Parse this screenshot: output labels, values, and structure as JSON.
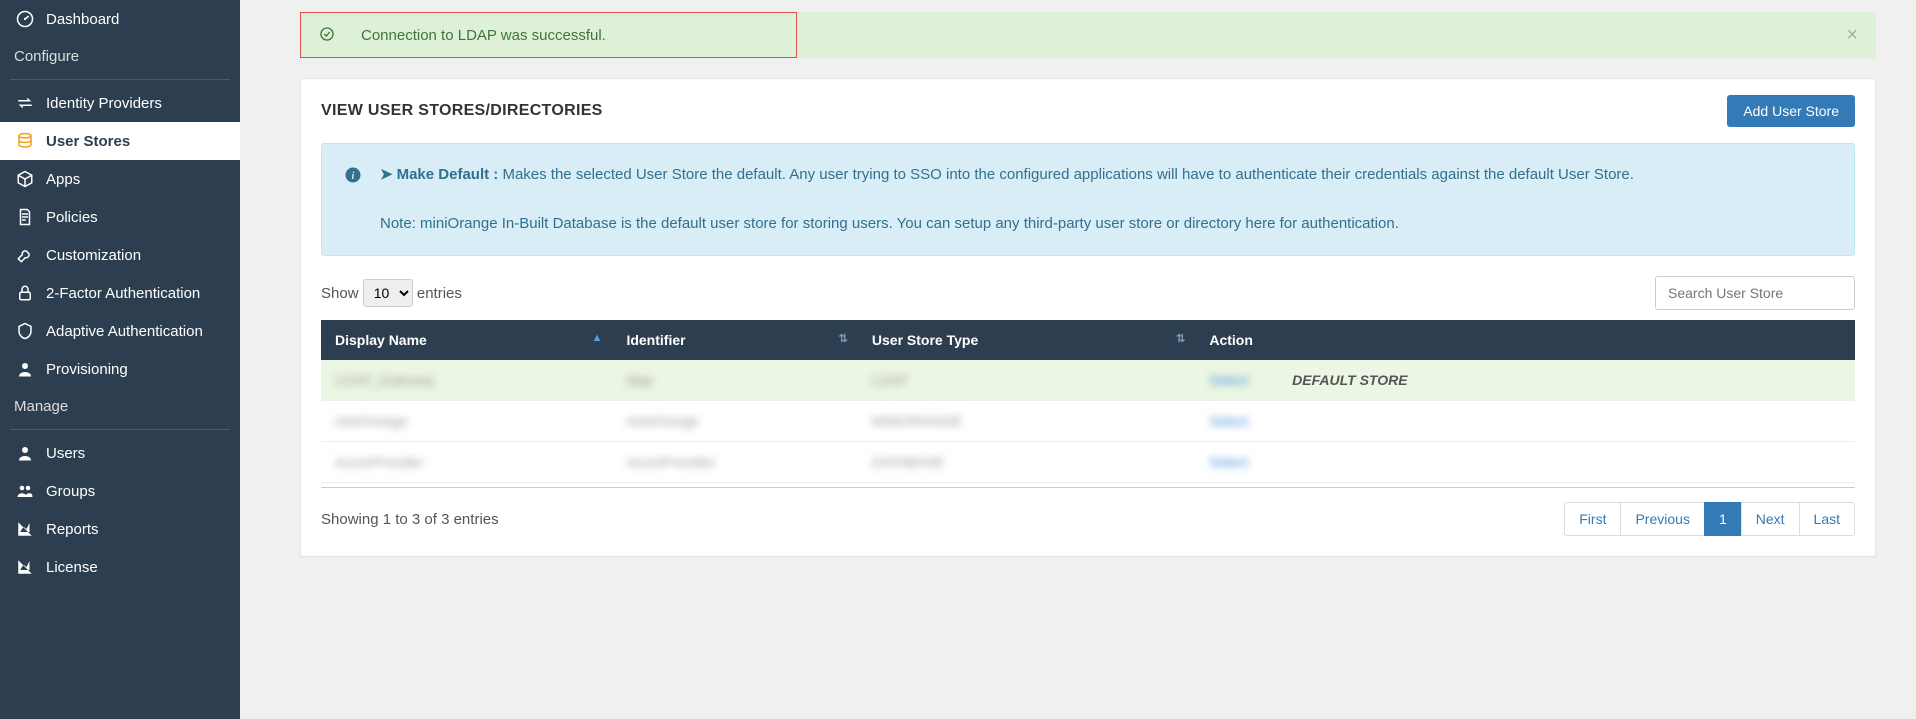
{
  "sidebar": {
    "dashboard": "Dashboard",
    "configure": "Configure",
    "identity_providers": "Identity Providers",
    "user_stores": "User Stores",
    "apps": "Apps",
    "policies": "Policies",
    "customization": "Customization",
    "two_factor": "2-Factor Authentication",
    "adaptive": "Adaptive Authentication",
    "provisioning": "Provisioning",
    "manage": "Manage",
    "users": "Users",
    "groups": "Groups",
    "reports": "Reports",
    "license": "License"
  },
  "alert": {
    "message": "Connection to LDAP was successful."
  },
  "panel": {
    "title": "VIEW USER STORES/DIRECTORIES",
    "add_button": "Add User Store"
  },
  "info": {
    "make_default_label": "Make Default :",
    "make_default_text": " Makes the selected User Store the default. Any user trying to SSO into the configured applications will have to authenticate their credentials against the default User Store.",
    "note_text": "Note: miniOrange In-Built Database is the default user store for storing users. You can setup any third-party user store or directory here for authentication."
  },
  "table": {
    "show_label": "Show ",
    "entries_label": " entries",
    "page_size": "10",
    "search_placeholder": "Search User Store",
    "columns": {
      "display_name": "Display Name",
      "identifier": "Identifier",
      "user_store_type": "User Store Type",
      "action": "Action"
    },
    "rows": [
      {
        "display": "LDAP_Gateway",
        "identifier": "ldap",
        "type": "LDAP",
        "action": "Select",
        "default": true
      },
      {
        "display": "miniOrange",
        "identifier": "miniOrange",
        "type": "MINIORANGE",
        "action": "Select",
        "default": false
      },
      {
        "display": "AzureProvider",
        "identifier": "AzureProvider",
        "type": "DATABASE",
        "action": "Select",
        "default": false
      }
    ],
    "default_badge": "DEFAULT STORE",
    "footer_info": "Showing 1 to 3 of 3 entries",
    "pager": {
      "first": "First",
      "previous": "Previous",
      "page1": "1",
      "next": "Next",
      "last": "Last"
    }
  }
}
